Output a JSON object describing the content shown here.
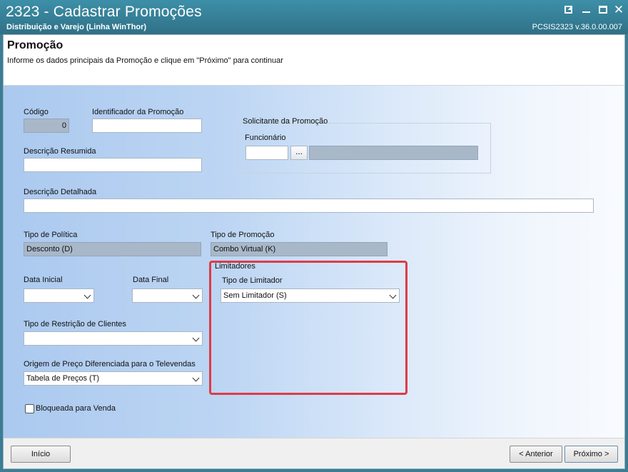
{
  "window": {
    "title": "2323 - Cadastrar Promoções",
    "subtitle": "Distribuição e Varejo (Linha WinThor)",
    "version": "PCSIS2323  v.36.0.00.007"
  },
  "header": {
    "title": "Promoção",
    "instructions": "Informe os dados principais da Promoção e clique em \"Próximo\" para continuar"
  },
  "form": {
    "codigo": {
      "label": "Código",
      "value": "0"
    },
    "identificador": {
      "label": "Identificador da Promoção",
      "value": ""
    },
    "descricao_resumida": {
      "label": "Descrição Resumida",
      "value": ""
    },
    "solicitante": {
      "group_label": "Solicitante da Promoção",
      "funcionario_label": "Funcionário",
      "funcionario_code": "",
      "lookup_button": "...",
      "funcionario_name": ""
    },
    "descricao_detalhada": {
      "label": "Descrição Detalhada",
      "value": ""
    },
    "tipo_politica": {
      "label": "Tipo de Política",
      "value": "Desconto (D)"
    },
    "tipo_promocao": {
      "label": "Tipo de Promoção",
      "value": "Combo Virtual (K)"
    },
    "data_inicial": {
      "label": "Data Inicial",
      "value": ""
    },
    "data_final": {
      "label": "Data Final",
      "value": ""
    },
    "limitadores": {
      "group_label": "Limitadores",
      "tipo_limitador_label": "Tipo de Limitador",
      "tipo_limitador_value": "Sem Limitador (S)"
    },
    "tipo_restricao": {
      "label": "Tipo de Restrição de Clientes",
      "value": ""
    },
    "origem_preco": {
      "label": "Origem de Preço Diferenciada para o Televendas",
      "value": "Tabela de Preços (T)"
    },
    "bloqueada": {
      "label": "Bloqueada para Venda",
      "checked": false
    }
  },
  "footer": {
    "inicio": "Início",
    "anterior": "< Anterior",
    "proximo": "Próximo >"
  },
  "colors": {
    "titlebar": "#3a8aa3",
    "highlight_box": "#de3b48",
    "readonly_field": "#a8b8c9"
  }
}
